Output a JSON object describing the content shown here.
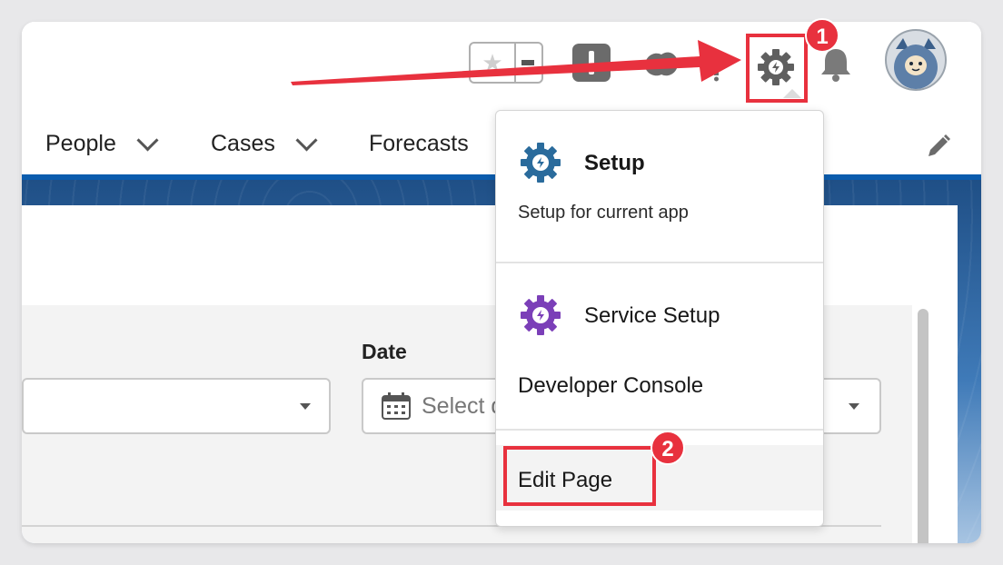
{
  "header": {
    "favorites_icon": "star-icon",
    "global_actions_icon": "plus-icon",
    "trailhead_icon": "trailhead-icon",
    "help_icon": "help-icon",
    "setup_icon": "gear-icon",
    "notifications_icon": "bell-icon",
    "avatar": "user-avatar"
  },
  "nav": {
    "items": [
      {
        "label": "People"
      },
      {
        "label": "Cases"
      },
      {
        "label": "Forecasts"
      }
    ],
    "edit_icon": "pencil-icon"
  },
  "content": {
    "date_label": "Date",
    "date_placeholder": "Select date"
  },
  "setup_menu": {
    "setup": {
      "title": "Setup",
      "subtitle": "Setup for current app",
      "color": "#2a6b9c"
    },
    "service_setup": {
      "title": "Service Setup",
      "color": "#7b3fb8"
    },
    "developer_console": "Developer Console",
    "edit_page": "Edit Page"
  },
  "annotations": {
    "step_1": "1",
    "step_2": "2",
    "highlight_color": "#e8313e"
  }
}
